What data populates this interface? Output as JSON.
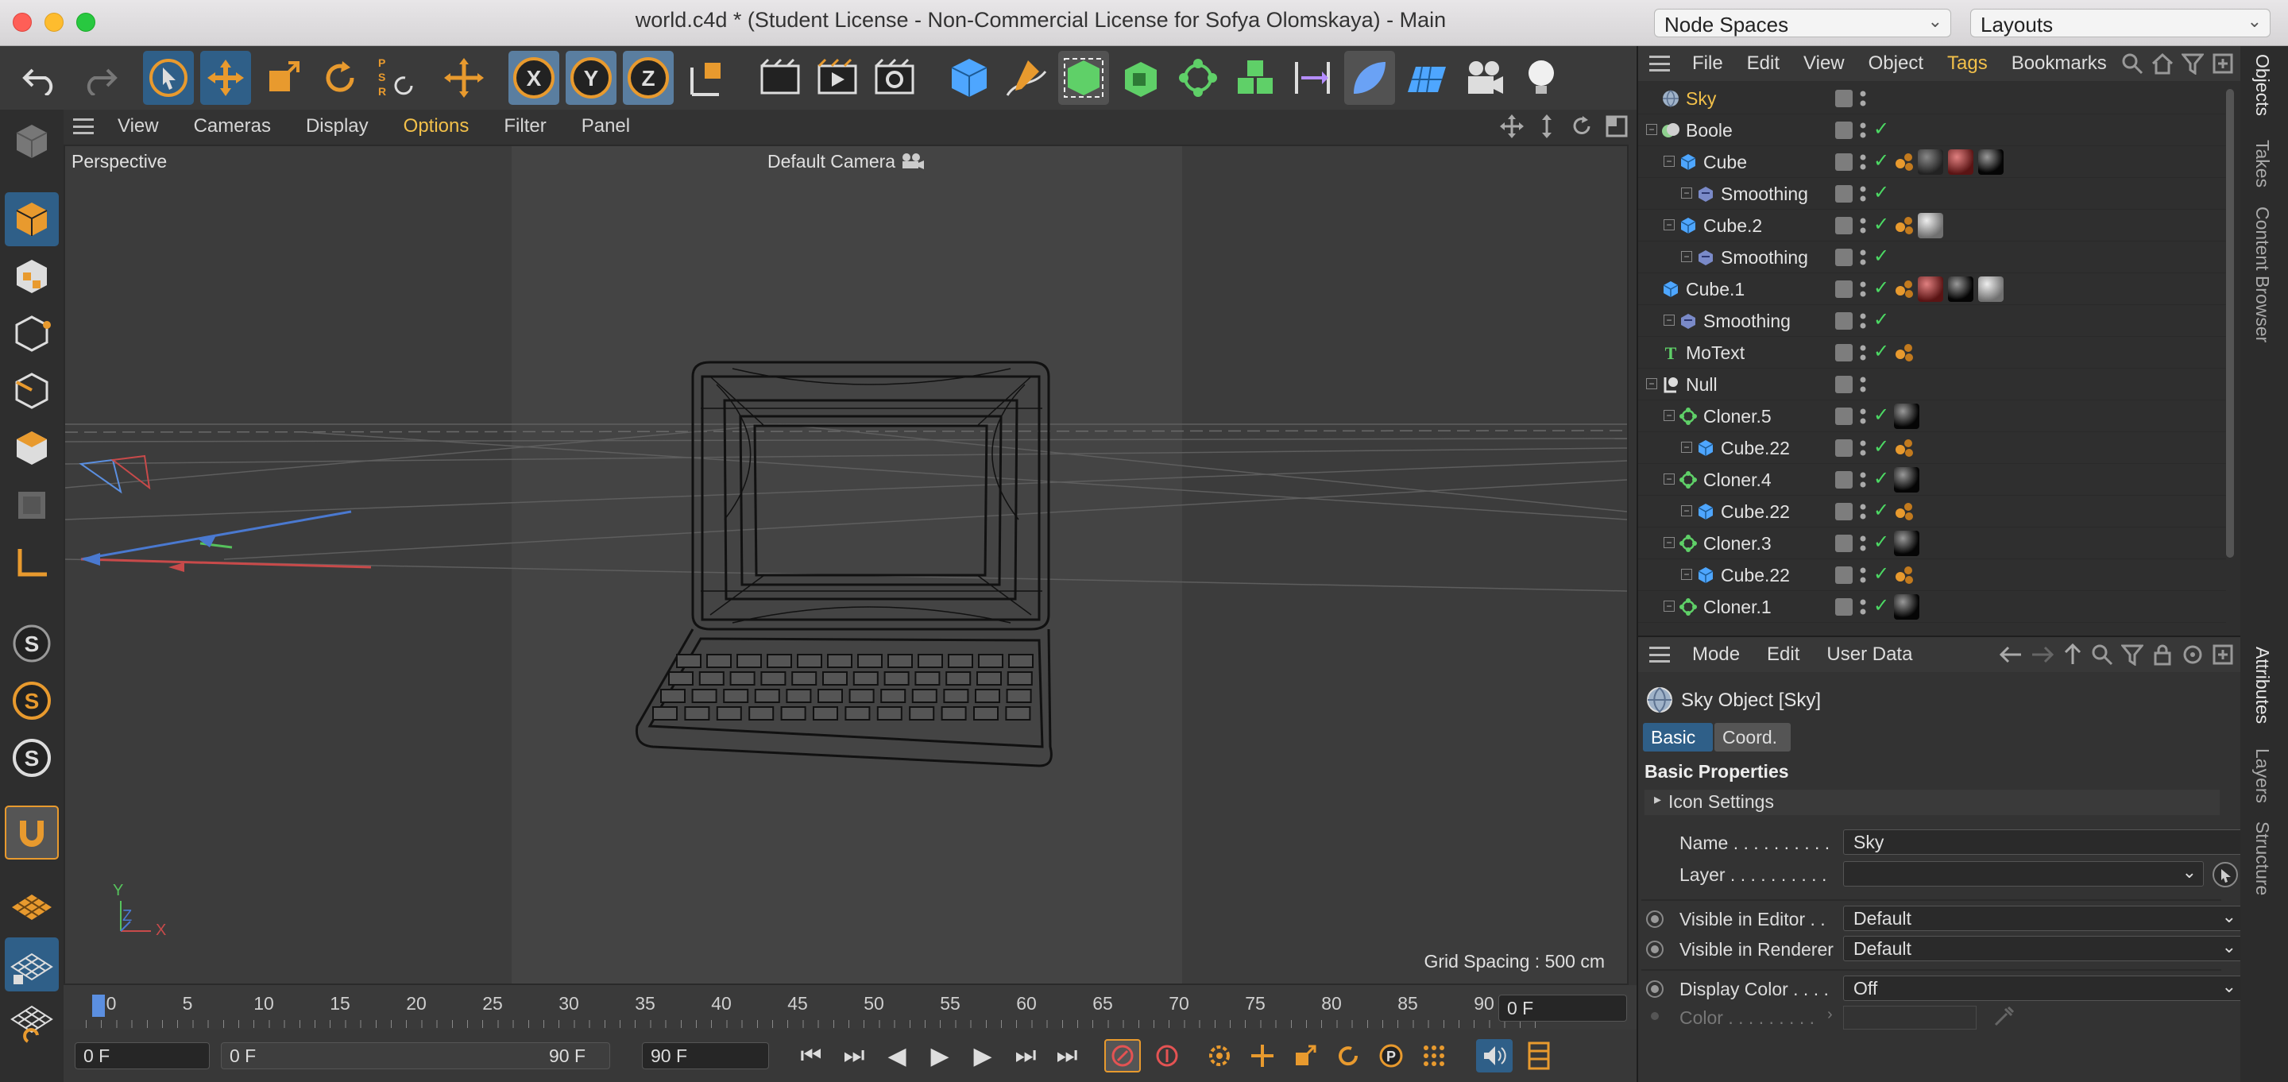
{
  "window": {
    "title": "world.c4d * (Student License - Non-Commercial License for Sofya Olomskaya) - Main",
    "node_spaces": "Node Spaces",
    "layouts": "Layouts"
  },
  "toolbar": {
    "icons": [
      "undo-icon",
      "redo-icon",
      "live-selection-icon",
      "move-icon",
      "scale-icon",
      "rotate-icon",
      "psr-icon",
      "move-axis-icon",
      "x-axis-icon",
      "y-axis-icon",
      "z-axis-icon",
      "coordinate-system-icon",
      "render-view-icon",
      "render-picture-viewer-icon",
      "render-settings-icon",
      "cube-icon",
      "pen-icon",
      "subdivision-surface-icon",
      "extrude-icon",
      "cloner-icon",
      "array-icon",
      "symmetry-icon",
      "deformer-icon",
      "floor-icon",
      "camera-icon",
      "light-icon"
    ],
    "axis_labels": [
      "X",
      "Y",
      "Z"
    ],
    "psr_label": "PSR"
  },
  "left_tools": [
    "make-editable-icon",
    "model-mode-icon",
    "texture-mode-icon",
    "points-mode-icon",
    "edges-mode-icon",
    "polygons-mode-icon",
    "uv-mode-icon",
    "axis-mode-icon",
    "snap-icon",
    "snap-settings-icon",
    "snap-workplane-icon",
    "magnet-icon",
    "workplane-icon",
    "grid-icon",
    "locked-workplane-icon"
  ],
  "viewport": {
    "menu": [
      "View",
      "Cameras",
      "Display",
      "Options",
      "Filter",
      "Panel"
    ],
    "active_menu": "Options",
    "view_name": "Perspective",
    "camera": "Default Camera",
    "grid_spacing": "Grid Spacing : 500 cm",
    "axis": {
      "x": "X",
      "y": "Y",
      "z": "Z"
    }
  },
  "timeline": {
    "ticks": [
      "0",
      "5",
      "10",
      "15",
      "20",
      "25",
      "30",
      "35",
      "40",
      "45",
      "50",
      "55",
      "60",
      "65",
      "70",
      "75",
      "80",
      "85",
      "90"
    ],
    "current_frame_field": "0 F",
    "start_field": "0 F",
    "range_start": "0 F",
    "range_end": "90 F",
    "end_field": "90 F"
  },
  "object_manager": {
    "menu": [
      "File",
      "Edit",
      "View",
      "Object",
      "Tags",
      "Bookmarks"
    ],
    "active_menu": "Tags",
    "rows": [
      {
        "name": "Sky",
        "indent": 0,
        "icon": "sky",
        "selected": true,
        "check": false,
        "tags": []
      },
      {
        "name": "Boole",
        "indent": 0,
        "icon": "boole",
        "check": true,
        "tags": []
      },
      {
        "name": "Cube",
        "indent": 1,
        "icon": "cube",
        "check": true,
        "tags": [
          "phong",
          "dark",
          "red",
          "black"
        ]
      },
      {
        "name": "Smoothing",
        "indent": 2,
        "icon": "smoothing",
        "check": true,
        "tags": []
      },
      {
        "name": "Cube.2",
        "indent": 1,
        "icon": "cube",
        "check": true,
        "tags": [
          "phong",
          "grey"
        ]
      },
      {
        "name": "Smoothing",
        "indent": 2,
        "icon": "smoothing",
        "check": true,
        "tags": []
      },
      {
        "name": "Cube.1",
        "indent": 0,
        "icon": "cube",
        "check": true,
        "tags": [
          "phong",
          "red",
          "black",
          "grey"
        ]
      },
      {
        "name": "Smoothing",
        "indent": 1,
        "icon": "smoothing",
        "check": true,
        "tags": []
      },
      {
        "name": "MoText",
        "indent": 0,
        "icon": "motext",
        "check": true,
        "tags": [
          "phong"
        ]
      },
      {
        "name": "Null",
        "indent": 0,
        "icon": "null",
        "check": false,
        "tags": []
      },
      {
        "name": "Cloner.5",
        "indent": 1,
        "icon": "cloner",
        "check": true,
        "tags": [
          "black"
        ]
      },
      {
        "name": "Cube.22",
        "indent": 2,
        "icon": "cube",
        "check": true,
        "tags": [
          "phong"
        ]
      },
      {
        "name": "Cloner.4",
        "indent": 1,
        "icon": "cloner",
        "check": true,
        "tags": [
          "black"
        ]
      },
      {
        "name": "Cube.22",
        "indent": 2,
        "icon": "cube",
        "check": true,
        "tags": [
          "phong"
        ]
      },
      {
        "name": "Cloner.3",
        "indent": 1,
        "icon": "cloner",
        "check": true,
        "tags": [
          "black"
        ]
      },
      {
        "name": "Cube.22",
        "indent": 2,
        "icon": "cube",
        "check": true,
        "tags": [
          "phong"
        ]
      },
      {
        "name": "Cloner.1",
        "indent": 1,
        "icon": "cloner",
        "check": true,
        "tags": [
          "black"
        ]
      }
    ]
  },
  "attributes": {
    "menu": [
      "Mode",
      "Edit",
      "User Data"
    ],
    "object_title": "Sky Object [Sky]",
    "tabs": [
      "Basic",
      "Coord."
    ],
    "active_tab": "Basic",
    "section": "Basic Properties",
    "icon_settings": "Icon Settings",
    "fields": {
      "name_label": "Name . . . . . . . . . .",
      "name_value": "Sky",
      "layer_label": "Layer . . . . . . . . . .",
      "visible_editor_label": "Visible in Editor . .",
      "visible_editor_value": "Default",
      "visible_renderer_label": "Visible in Renderer",
      "visible_renderer_value": "Default",
      "display_color_label": "Display Color . . . .",
      "display_color_value": "Off",
      "color_label": "Color . . . . . . . . ."
    }
  },
  "side_tabs": {
    "top": [
      "Objects",
      "Takes",
      "Content Browser"
    ],
    "bottom": [
      "Attributes",
      "Layers",
      "Structure"
    ]
  },
  "colors": {
    "accent": "#f2c04a",
    "selection": "#2f5f88",
    "check": "#4cd964",
    "orange": "#e89a2e"
  }
}
